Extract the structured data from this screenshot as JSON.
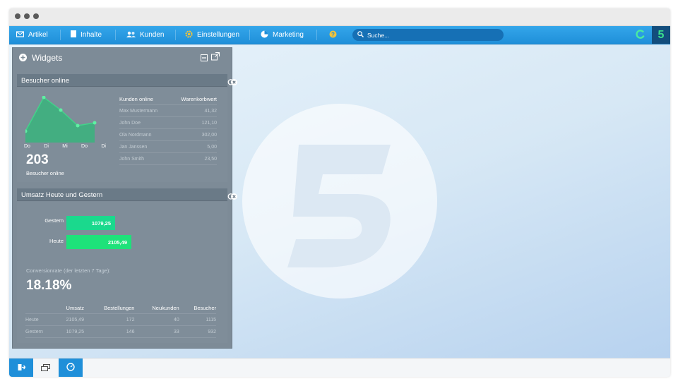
{
  "nav": {
    "items": [
      {
        "label": "Artikel",
        "icon": "articles-icon"
      },
      {
        "label": "Inhalte",
        "icon": "content-icon"
      },
      {
        "label": "Kunden",
        "icon": "customers-icon"
      },
      {
        "label": "Einstellungen",
        "icon": "gear-icon"
      },
      {
        "label": "Marketing",
        "icon": "marketing-icon"
      }
    ],
    "help_icon": "help-icon",
    "search_placeholder": "Suche...",
    "brand_letter": "5"
  },
  "panel": {
    "title": "Widgets",
    "visitors": {
      "title": "Besucher online",
      "days": [
        "Do",
        "Di",
        "Mi",
        "Do",
        "Di"
      ],
      "count": "203",
      "count_label": "Besucher online",
      "table_headers": [
        "Kunden online",
        "Warenkorbwert"
      ],
      "rows": [
        [
          "Max Mustermann",
          "41,32"
        ],
        [
          "John Doe",
          "121,10"
        ],
        [
          "Ola Nordmann",
          "302,00"
        ],
        [
          "Jan Janssen",
          "5,00"
        ],
        [
          "John Smith",
          "23,50"
        ]
      ]
    },
    "sales": {
      "title": "Umsatz Heute und Gestern",
      "bars": [
        {
          "label": "Gestern",
          "value": "1079,25"
        },
        {
          "label": "Heute",
          "value": "2105,49"
        }
      ],
      "conversion_label": "Conversionrate (der letzten 7 Tage):",
      "conversion_value": "18.18%",
      "table_headers": [
        "",
        "Umsatz",
        "Bestellungen",
        "Neukunden",
        "Besucher"
      ],
      "rows": [
        [
          "Heute",
          "2105,49",
          "172",
          "40",
          "1115"
        ],
        [
          "Gestern",
          "1079,25",
          "146",
          "33",
          "932"
        ]
      ]
    }
  },
  "colors": {
    "topbar": "#2196e0",
    "panel": "#7d8b97",
    "chart_green": "#34c97c",
    "bar_green": "#1ee27a"
  }
}
